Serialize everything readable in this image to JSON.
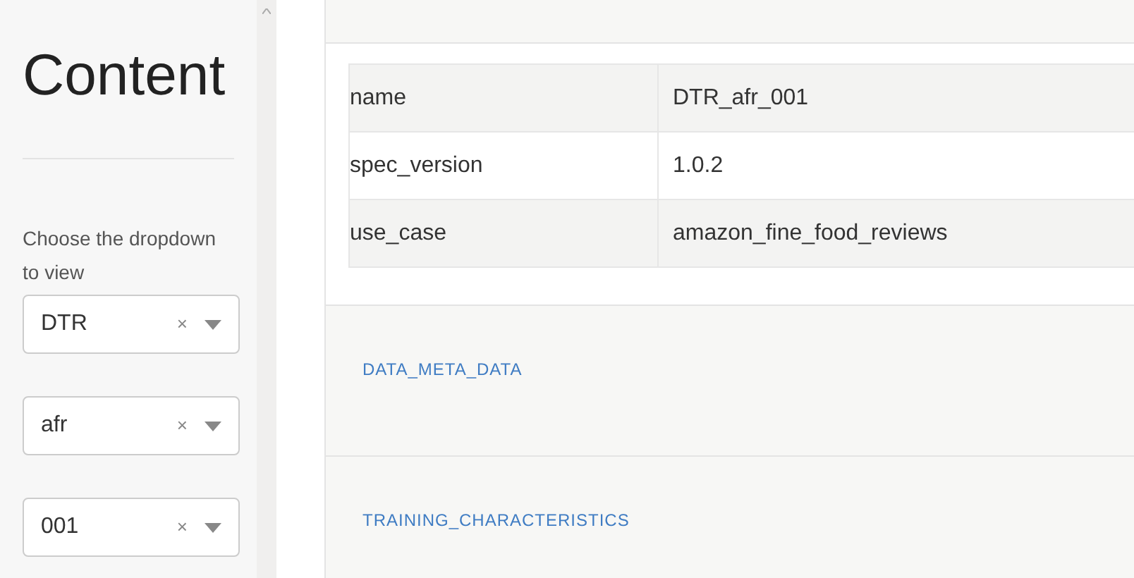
{
  "sidebar": {
    "title": "Content",
    "prompt": "Choose the dropdown to view",
    "dropdowns": [
      {
        "value": "DTR",
        "clear": "×"
      },
      {
        "value": "afr",
        "clear": "×"
      },
      {
        "value": "001",
        "clear": "×"
      }
    ]
  },
  "table": {
    "rows": [
      {
        "key": "name",
        "value": "DTR_afr_001"
      },
      {
        "key": "spec_version",
        "value": "1.0.2"
      },
      {
        "key": "use_case",
        "value": "amazon_fine_food_reviews"
      }
    ]
  },
  "sections": [
    {
      "title": "DATA_META_DATA"
    },
    {
      "title": "TRAINING_CHARACTERISTICS"
    }
  ]
}
